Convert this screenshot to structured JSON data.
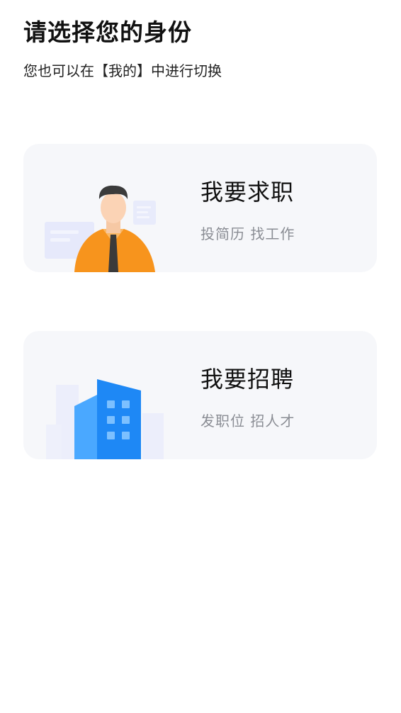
{
  "header": {
    "title": "请选择您的身份",
    "subtitle": "您也可以在【我的】中进行切换"
  },
  "roles": [
    {
      "title": "我要求职",
      "subtitle": "投简历 找工作",
      "illustration": "job-seeker-person-icon"
    },
    {
      "title": "我要招聘",
      "subtitle": "发职位 招人才",
      "illustration": "building-icon"
    }
  ],
  "colors": {
    "card_bg": "#f6f7fa",
    "subtitle_gray": "#8a8d94",
    "shirt_orange": "#f7941d",
    "building_blue": "#1e90ff"
  }
}
